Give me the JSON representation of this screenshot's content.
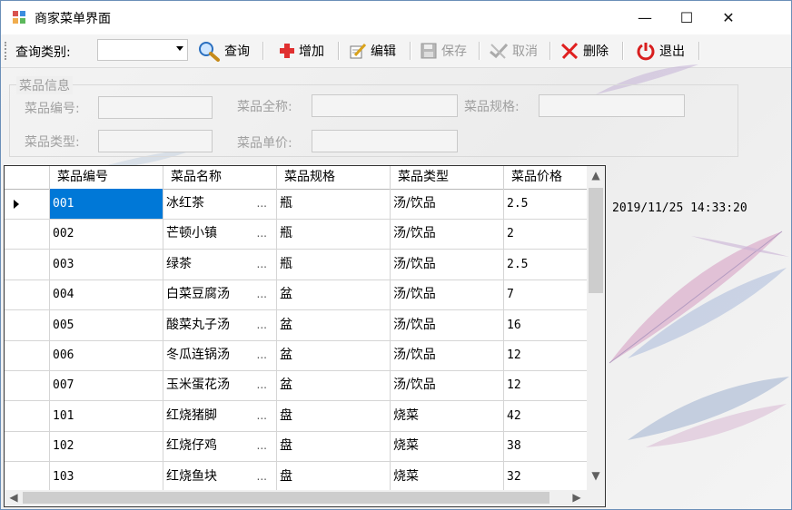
{
  "window": {
    "title": "商家菜单界面",
    "minimize_glyph": "—",
    "maximize_glyph": "☐",
    "close_glyph": "✕"
  },
  "toolbar": {
    "category_label": "查询类别:",
    "category_value": "",
    "query_label": "查询",
    "add_label": "增加",
    "edit_label": "编辑",
    "save_label": "保存",
    "cancel_label": "取消",
    "delete_label": "删除",
    "exit_label": "退出"
  },
  "group": {
    "title": "菜品信息",
    "code_label": "菜品编号:",
    "name_label": "菜品全称:",
    "spec_label": "菜品规格:",
    "type_label": "菜品类型:",
    "price_label": "菜品单价:"
  },
  "timestamp": "2019/11/25 14:33:20",
  "grid": {
    "headers": [
      "菜品编号",
      "菜品名称",
      "菜品规格",
      "菜品类型",
      "菜品价格"
    ],
    "ellipsis": "...",
    "rows": [
      [
        "001",
        "冰红茶",
        "瓶",
        "汤/饮品",
        "2.5"
      ],
      [
        "002",
        "芒顿小镇",
        "瓶",
        "汤/饮品",
        "2"
      ],
      [
        "003",
        "绿茶",
        "瓶",
        "汤/饮品",
        "2.5"
      ],
      [
        "004",
        "白菜豆腐汤",
        "盆",
        "汤/饮品",
        "7"
      ],
      [
        "005",
        "酸菜丸子汤",
        "盆",
        "汤/饮品",
        "16"
      ],
      [
        "006",
        "冬瓜连锅汤",
        "盆",
        "汤/饮品",
        "12"
      ],
      [
        "007",
        "玉米蛋花汤",
        "盆",
        "汤/饮品",
        "12"
      ],
      [
        "101",
        "红烧猪脚",
        "盘",
        "烧菜",
        "42"
      ],
      [
        "102",
        "红烧仔鸡",
        "盘",
        "烧菜",
        "38"
      ],
      [
        "103",
        "红烧鱼块",
        "盘",
        "烧菜",
        "32"
      ]
    ]
  }
}
